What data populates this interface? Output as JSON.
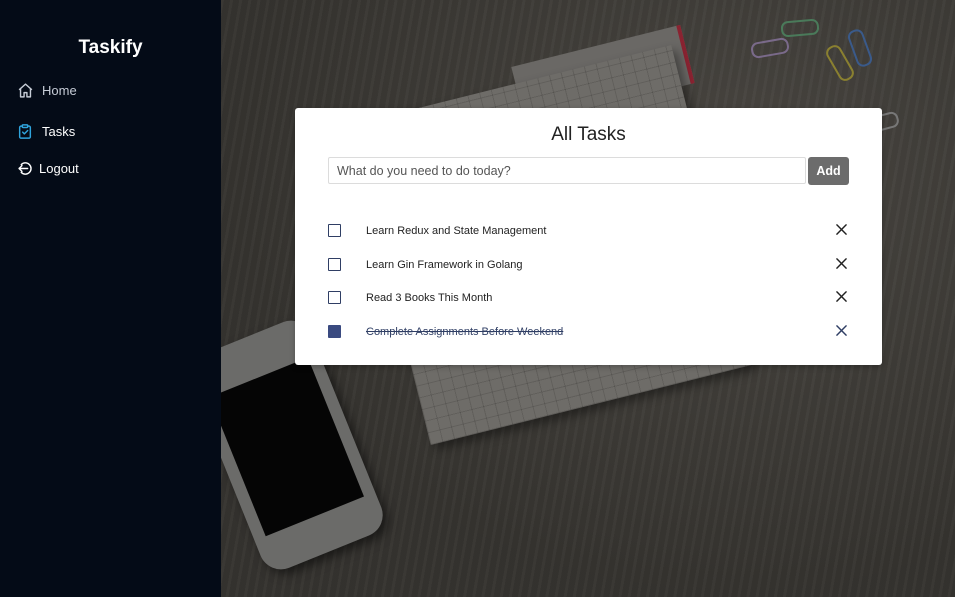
{
  "app": {
    "brand": "Taskify"
  },
  "sidebar": {
    "items": [
      {
        "label": "Home",
        "icon": "home-icon"
      },
      {
        "label": "Tasks",
        "icon": "clipboard-check-icon"
      },
      {
        "label": "Logout",
        "icon": "logout-icon"
      }
    ]
  },
  "card": {
    "title": "All Tasks",
    "input_placeholder": "What do you need to do today?",
    "input_value": "",
    "add_label": "Add"
  },
  "tasks": [
    {
      "text": "Learn Redux and State Management",
      "completed": false
    },
    {
      "text": "Learn Gin Framework in Golang",
      "completed": false
    },
    {
      "text": "Read 3 Books This Month",
      "completed": false
    },
    {
      "text": "Complete Assignments Before Weekend",
      "completed": true
    }
  ],
  "colors": {
    "sidebar_bg": "#040b17",
    "accent": "#2f3e64",
    "add_button": "#6c6c6c"
  }
}
